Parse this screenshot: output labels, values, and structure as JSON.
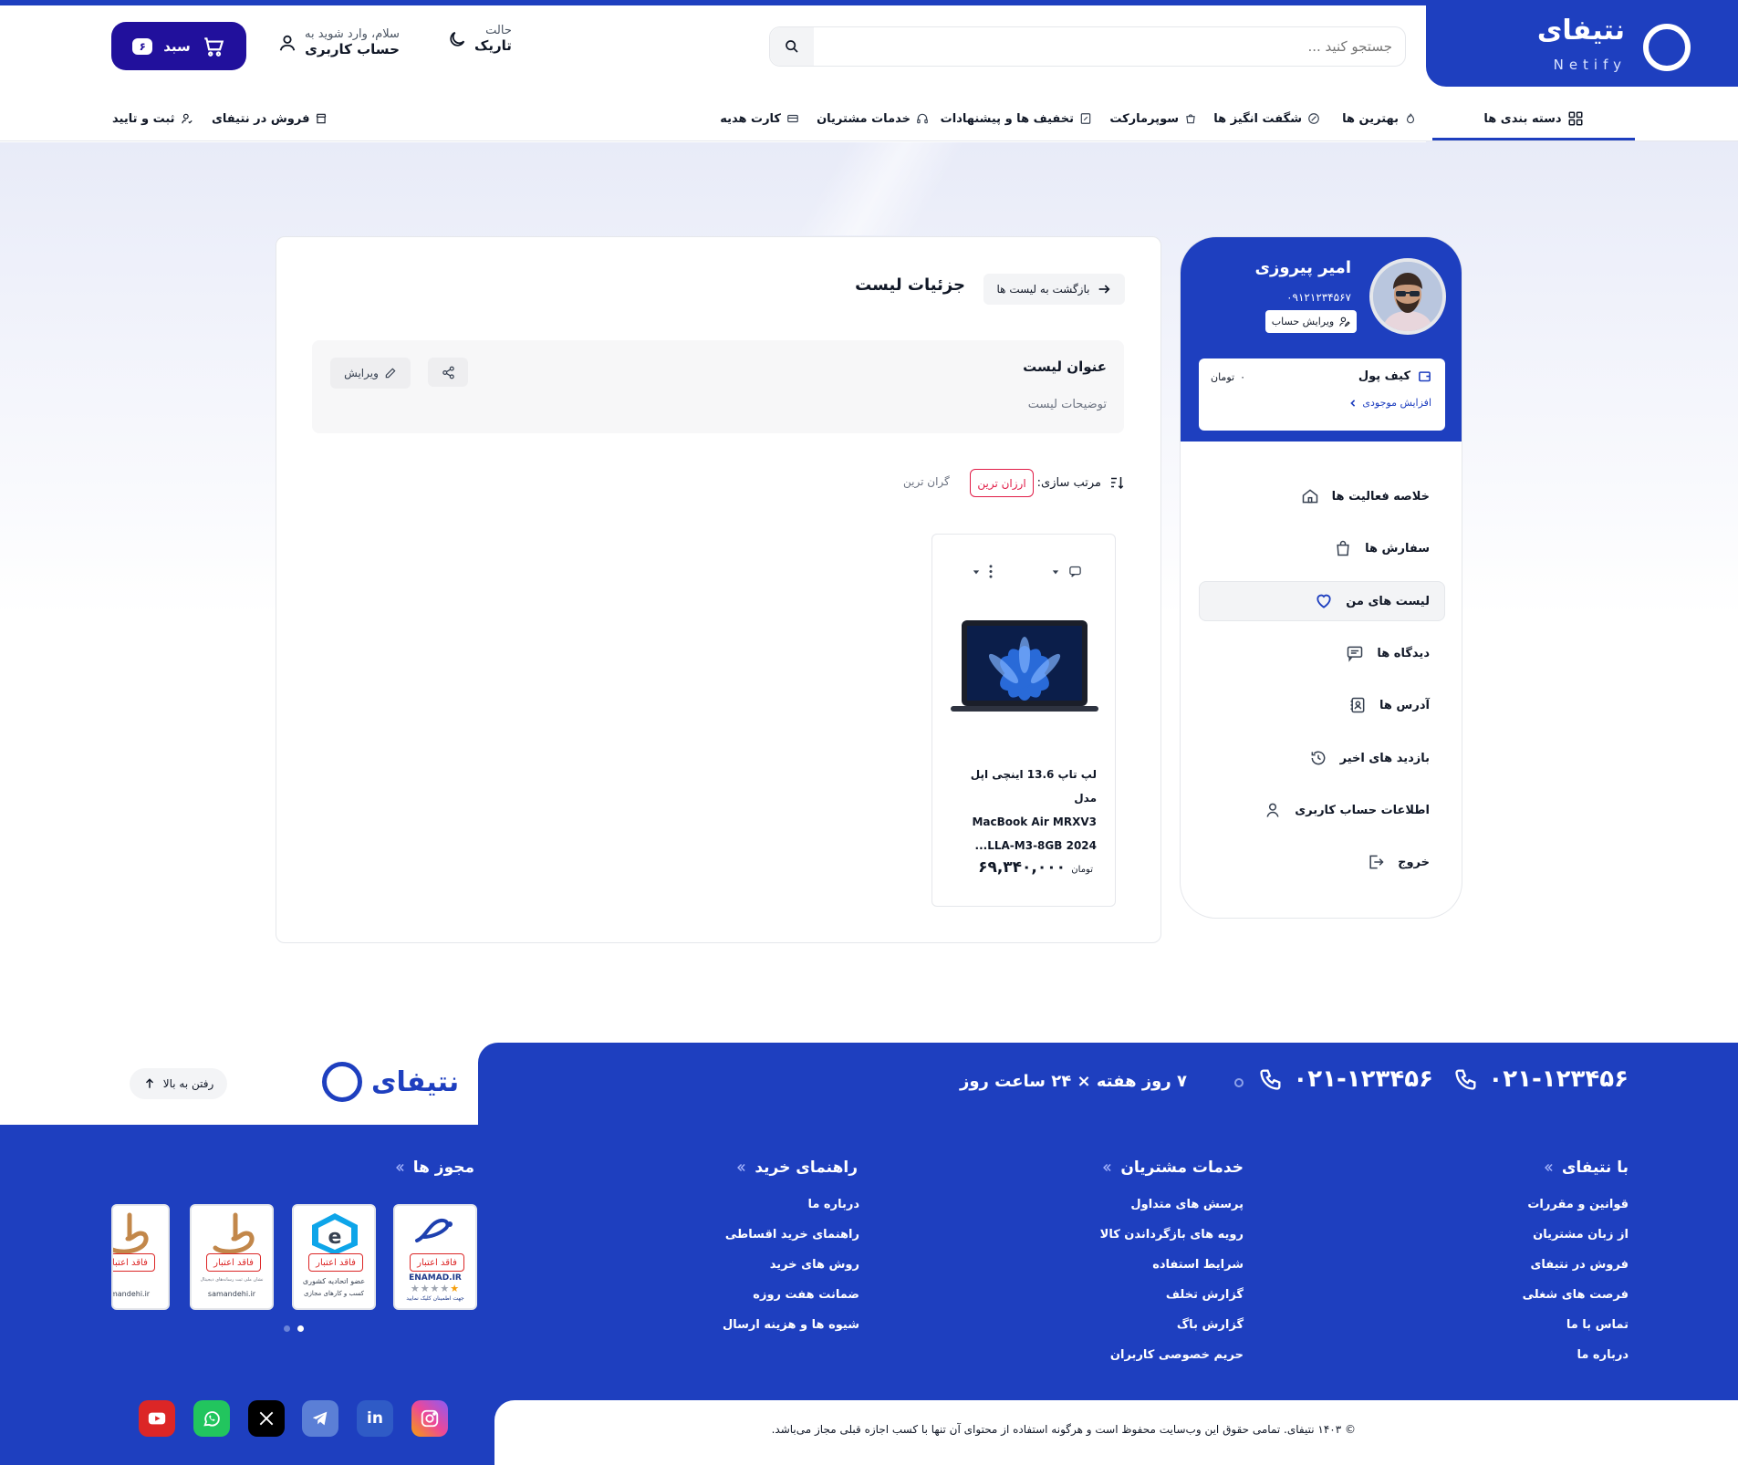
{
  "header": {
    "logo_name": "نتیفای",
    "logo_sub": "Netify",
    "search_placeholder": "جستجو کنید ...",
    "theme_small": "حالت",
    "theme_label": "تاریک",
    "account_small": "سلام، وارد شوید به",
    "account_label": "حساب کاربری",
    "cart_label": "سبد",
    "cart_count": "۶"
  },
  "nav": {
    "categories": "دسته بندی ها",
    "best": "بهترین ها",
    "amazing": "شگفت انگیز ها",
    "supermarket": "سوپرمارکت",
    "offers": "تخفیف ها و پیشنهادات",
    "services": "خدمات مشتریان",
    "giftcard": "کارت هدیه",
    "sell": "فروش در نتیفای",
    "register": "ثبت و تایید"
  },
  "main": {
    "back_label": "بازگشت به لیست ها",
    "page_title": "جزئیات لیست",
    "list_title": "عنوان لیست",
    "list_desc": "توضیحات لیست",
    "edit_label": "ویرایش",
    "sort_label": "مرتب سازی:",
    "sort_active": "ارزان ترین",
    "sort_other": "گران ترین"
  },
  "product": {
    "name_line1": "لپ تاپ 13.6 اینچی اپل مدل",
    "name_line2": "MacBook Air MRXV3",
    "name_line3": "2024 LLA-M3-8GB...",
    "price": "۶۹,۳۴۰,۰۰۰",
    "currency": "تومان"
  },
  "sidebar": {
    "user_name": "امیر پیروزی",
    "user_phone": "۰۹۱۲۱۲۳۴۵۶۷",
    "edit_account": "ویرایش حساب",
    "wallet_label": "کیف پول",
    "wallet_amount": "۰",
    "wallet_currency": "تومان",
    "wallet_increase": "افزایش موجودی",
    "items": [
      {
        "label": "خلاصه فعالیت ها",
        "icon": "home-icon"
      },
      {
        "label": "سفارش ها",
        "icon": "bag-icon"
      },
      {
        "label": "لیست های من",
        "icon": "heart-icon"
      },
      {
        "label": "دیدگاه ها",
        "icon": "comment-icon"
      },
      {
        "label": "آدرس ها",
        "icon": "address-book-icon"
      },
      {
        "label": "بازدید های اخیر",
        "icon": "history-icon"
      },
      {
        "label": "اطلاعات حساب کاربری",
        "icon": "user-icon"
      },
      {
        "label": "خروج",
        "icon": "logout-icon"
      }
    ]
  },
  "footer": {
    "phone1": "۰۲۱-۱۲۳۴۵۶",
    "phone2": "۰۲۱-۱۲۳۴۵۶",
    "support_hours": "۷ روز هفته × ۲۴ ساعت روز",
    "logo_name": "نتیفای",
    "go_top": "رفتن به بالا",
    "columns": [
      {
        "title": "با نتیفای",
        "links": [
          "قوانین و مقررات",
          "از زبان مشتریان",
          "فروش در نتیفای",
          "فرصت های شغلی",
          "تماس با ما",
          "درباره ما"
        ]
      },
      {
        "title": "خدمات مشتریان",
        "links": [
          "پرسش های متداول",
          "رویه های بازگرداندن کالا",
          "شرایط استفاده",
          "گزارش تخلف",
          "گزارش باگ",
          "حریم خصوصی کاربران"
        ]
      },
      {
        "title": "راهنمای خرید",
        "links": [
          "درباره ما",
          "راهنمای خرید اقساطی",
          "روش های خرید",
          "ضمانت هفت روزه",
          "شیوه ها و هزینه ارسال"
        ]
      }
    ],
    "licenses_title": "مجوز ها",
    "badge_tag": "فاقد اعتبار",
    "badge_enamad": "ENAMAD.IR",
    "badge_enamad_sub": "جهت اطمینان کلیک نمایید",
    "badge_union": "عضو اتحادیه کشوری",
    "badge_union_sub": "کسب و کارهای مجازی",
    "badge_samandehi": "samandehi.ir",
    "badge_samandehi_sub": "نشان ملی ثبت رسانه‌های دیجیتال",
    "copyright": "© ۱۴۰۳ نتیفای. تمامی حقوق این وب‌سایت محفوظ است و هرگونه استفاده از محتوای آن تنها با کسب اجازه قبلی مجاز می‌باشد."
  },
  "colors": {
    "brand": "#1e3fbf",
    "cart": "#21109c",
    "accent_red": "#e11d48"
  }
}
